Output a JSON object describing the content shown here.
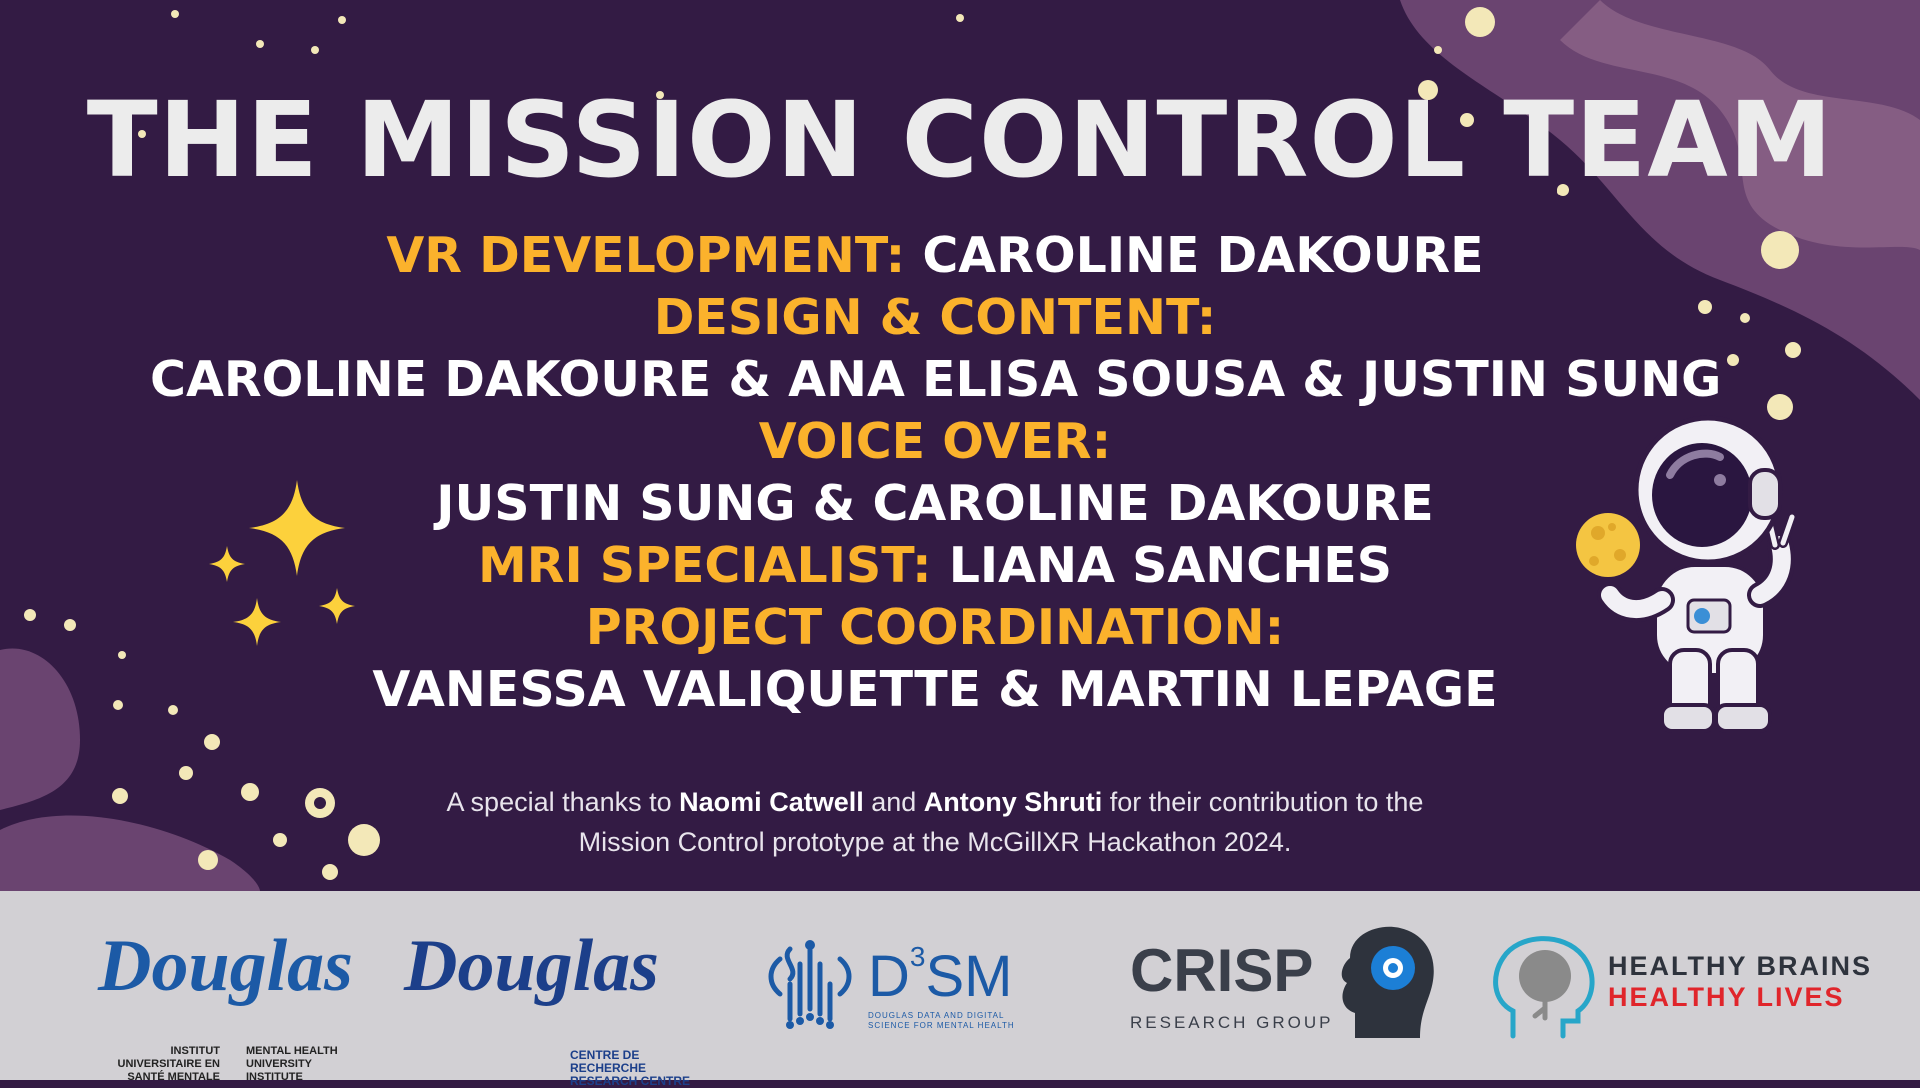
{
  "title": "THE MISSION CONTROL TEAM",
  "credits": {
    "vr_role": "VR DEVELOPMENT:",
    "vr_names": "CAROLINE DAKOURE",
    "design_role": "DESIGN & CONTENT:",
    "design_names": "CAROLINE DAKOURE & ANA ELISA SOUSA & JUSTIN SUNG",
    "voice_role": "VOICE OVER:",
    "voice_names": "JUSTIN SUNG & CAROLINE DAKOURE",
    "mri_role": "MRI SPECIALIST:",
    "mri_names": "LIANA SANCHES",
    "coord_role": "PROJECT COORDINATION:",
    "coord_names": "VANESSA VALIQUETTE & MARTIN LEPAGE"
  },
  "thanks": {
    "part1": "A special thanks to ",
    "name1": "Naomi Catwell",
    "part2": " and ",
    "name2": "Antony Shruti",
    "part3": " for their contribution to the",
    "line2": "Mission Control prototype at the McGillXR Hackathon 2024."
  },
  "logos": {
    "douglas1": {
      "word": "Douglas",
      "fr_line1": "INSTITUT",
      "fr_line2": "UNIVERSITAIRE EN",
      "fr_line3": "SANTÉ MENTALE",
      "en_line1": "MENTAL HEALTH",
      "en_line2": "UNIVERSITY",
      "en_line3": "INSTITUTE"
    },
    "douglas2": {
      "word": "Douglas",
      "line1": "CENTRE DE RECHERCHE",
      "line2": "RESEARCH CENTRE"
    },
    "d3sm": {
      "name_d": "D",
      "name_sup": "3",
      "name_sm": "SM",
      "line1": "DOUGLAS DATA AND DIGITAL",
      "line2": "SCIENCE FOR MENTAL HEALTH"
    },
    "crisp": {
      "name": "CRISP",
      "sub": "RESEARCH GROUP"
    },
    "hbhl": {
      "line1": "HEALTHY BRAINS",
      "line2": "HEALTHY LIVES"
    }
  },
  "colors": {
    "background": "#331b44",
    "role": "#fbb22c",
    "names": "#ffffff",
    "title": "#ececec",
    "footer": "#d2d0d4",
    "douglas_blue": "#1c5aa6",
    "hbhl_red": "#e0252b"
  },
  "icons": [
    "sparkle-icon",
    "astronaut-icon",
    "moon-icon",
    "brain-head-icon"
  ]
}
